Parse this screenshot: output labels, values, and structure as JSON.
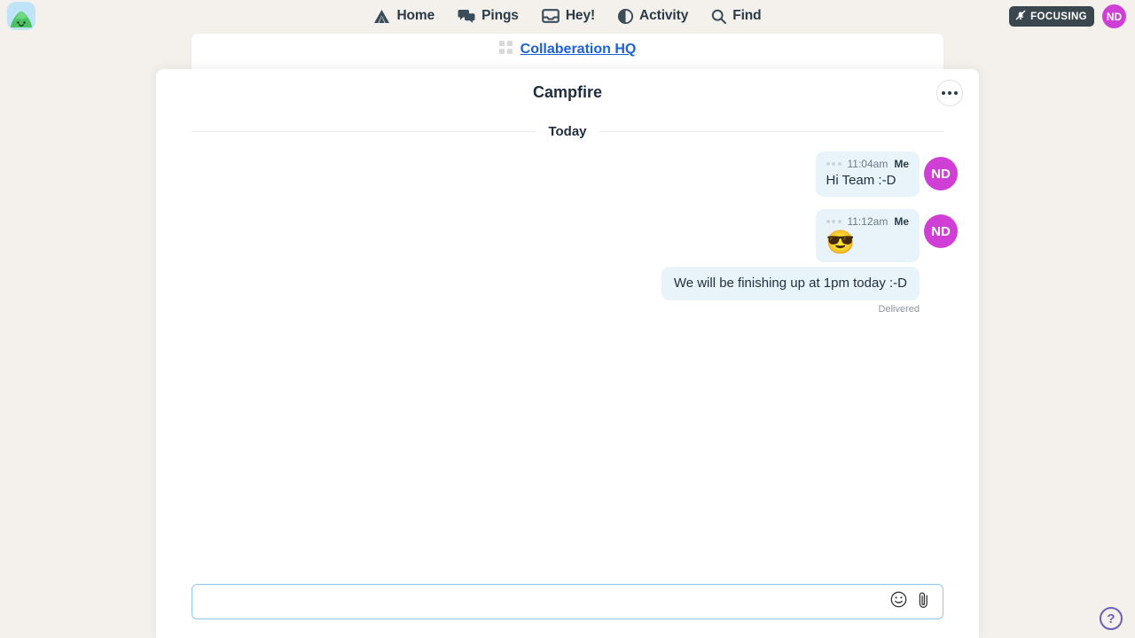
{
  "topbar": {
    "logo_name": "basecamp-logo",
    "nav": [
      {
        "label": "Home",
        "icon": "tent-icon"
      },
      {
        "label": "Pings",
        "icon": "chat-bubbles-icon"
      },
      {
        "label": "Hey!",
        "icon": "inbox-tray-icon"
      },
      {
        "label": "Activity",
        "icon": "half-circle-icon"
      },
      {
        "label": "Find",
        "icon": "search-icon"
      }
    ],
    "focusing_label": "FOCUSING",
    "focusing_icon": "bell-slash-icon",
    "avatar_initials": "ND"
  },
  "project": {
    "name": "Collaberation HQ",
    "icon": "grid-icon",
    "link_color": "#1c61d8"
  },
  "modal": {
    "title": "Campfire",
    "more_button_label": "...",
    "day_divider": "Today"
  },
  "messages": [
    {
      "time": "11:04am",
      "author": "Me",
      "text": "Hi Team :-D",
      "type": "text",
      "avatar": "ND",
      "show_avatar": true,
      "show_meta": true
    },
    {
      "time": "11:12am",
      "author": "Me",
      "text": "😎",
      "type": "emoji",
      "avatar": "ND",
      "show_avatar": true,
      "show_meta": true
    },
    {
      "time": "",
      "author": "Me",
      "text": "We will be finishing up at 1pm today :-D",
      "type": "text",
      "avatar": "ND",
      "show_avatar": false,
      "show_meta": false
    }
  ],
  "delivery_status": "Delivered",
  "composer": {
    "value": "",
    "placeholder": "",
    "emoji_icon": "smiley-face-icon",
    "attach_icon": "paperclip-icon",
    "border_color": "#8fc9ef"
  },
  "help": {
    "label": "?",
    "color": "#6c5fb8"
  },
  "colors": {
    "background": "#f4f1ed",
    "panel": "#ffffff",
    "bubble": "#e8f4fa",
    "avatar": "#cf3fd6",
    "text": "#1f2d3d",
    "focusing_bg": "#3b474f"
  }
}
